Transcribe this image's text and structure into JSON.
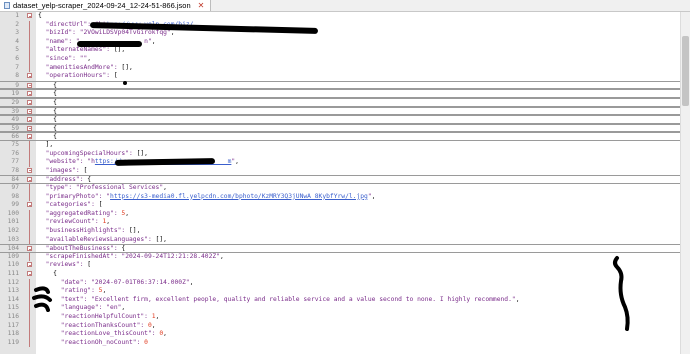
{
  "tab": {
    "title": "dataset_yelp-scraper_2024-09-24_12-24-51-866.json"
  },
  "lines": [
    {
      "n": "1",
      "fold": true,
      "parts": [
        [
          "p",
          "{"
        ]
      ]
    },
    {
      "n": "2",
      "parts": [
        [
          "k",
          "  \"directUrl\": "
        ],
        [
          "s",
          "\"ht"
        ],
        [
          "u",
          "tps://www.yelp.com/biz/"
        ],
        [
          "p",
          ""
        ]
      ]
    },
    {
      "n": "3",
      "parts": [
        [
          "k",
          "  \"bizId\": "
        ],
        [
          "s",
          "\"2VOwiLDSVp04TvGirokfqg\""
        ],
        [
          "p",
          ","
        ]
      ]
    },
    {
      "n": "4",
      "parts": [
        [
          "k",
          "  \"name\": "
        ],
        [
          "s",
          "\"                 n\""
        ],
        [
          "p",
          ","
        ]
      ]
    },
    {
      "n": "5",
      "parts": [
        [
          "k",
          "  \"alternateNames\": "
        ],
        [
          "p",
          "[],"
        ]
      ]
    },
    {
      "n": "6",
      "parts": [
        [
          "k",
          "  \"since\": "
        ],
        [
          "s",
          "\"\""
        ],
        [
          "p",
          ","
        ]
      ]
    },
    {
      "n": "7",
      "parts": [
        [
          "k",
          "  \"amenitiesAndMore\": "
        ],
        [
          "p",
          "[],"
        ]
      ]
    },
    {
      "n": "8",
      "fold": true,
      "parts": [
        [
          "k",
          "  \"operationHours\": "
        ],
        [
          "p",
          "["
        ]
      ]
    },
    {
      "n": "9",
      "fold": true,
      "box": true,
      "parts": [
        [
          "p",
          "    {"
        ]
      ]
    },
    {
      "n": "19",
      "fold": true,
      "box": true,
      "parts": [
        [
          "p",
          "    {"
        ]
      ]
    },
    {
      "n": "29",
      "fold": true,
      "box": true,
      "parts": [
        [
          "p",
          "    {"
        ]
      ]
    },
    {
      "n": "39",
      "fold": true,
      "box": true,
      "parts": [
        [
          "p",
          "    {"
        ]
      ]
    },
    {
      "n": "49",
      "fold": true,
      "box": true,
      "parts": [
        [
          "p",
          "    {"
        ]
      ]
    },
    {
      "n": "59",
      "fold": true,
      "box": true,
      "parts": [
        [
          "p",
          "    {"
        ]
      ]
    },
    {
      "n": "66",
      "fold": true,
      "box": true,
      "parts": [
        [
          "p",
          "    {"
        ]
      ]
    },
    {
      "n": "75",
      "parts": [
        [
          "p",
          "  ],"
        ]
      ]
    },
    {
      "n": "76",
      "parts": [
        [
          "k",
          "  \"upcomingSpecialHours\": "
        ],
        [
          "p",
          "[],"
        ]
      ]
    },
    {
      "n": "77",
      "parts": [
        [
          "k",
          "  \"website\": "
        ],
        [
          "s",
          "\"h"
        ],
        [
          "u",
          "ttps://www.                        m"
        ],
        [
          "s",
          "\""
        ],
        [
          "p",
          ","
        ]
      ]
    },
    {
      "n": "78",
      "fold": true,
      "parts": [
        [
          "k",
          "  \"images\": "
        ],
        [
          "p",
          "["
        ]
      ]
    },
    {
      "n": "84",
      "fold": true,
      "box": true,
      "parts": [
        [
          "k",
          "  \"address\": "
        ],
        [
          "p",
          "{"
        ]
      ]
    },
    {
      "n": "97",
      "parts": [
        [
          "k",
          "  \"type\": "
        ],
        [
          "s",
          "\"Professional Services\""
        ],
        [
          "p",
          ","
        ]
      ]
    },
    {
      "n": "98",
      "parts": [
        [
          "k",
          "  \"primaryPhoto\": "
        ],
        [
          "s",
          "\""
        ],
        [
          "u",
          "https://s3-media0.fl.yelpcdn.com/bphoto/KzMRY3Q3jUNwA_8KybfYrw/l.jpg"
        ],
        [
          "s",
          "\""
        ],
        [
          "p",
          ","
        ]
      ]
    },
    {
      "n": "99",
      "fold": true,
      "parts": [
        [
          "k",
          "  \"categories\": "
        ],
        [
          "p",
          "["
        ]
      ]
    },
    {
      "n": "100",
      "parts": [
        [
          "k",
          "  \"aggregatedRating\": "
        ],
        [
          "n",
          "5"
        ],
        [
          "p",
          ","
        ]
      ]
    },
    {
      "n": "101",
      "parts": [
        [
          "k",
          "  \"reviewCount\": "
        ],
        [
          "n",
          "1"
        ],
        [
          "p",
          ","
        ]
      ]
    },
    {
      "n": "102",
      "parts": [
        [
          "k",
          "  \"businessHighlights\": "
        ],
        [
          "p",
          "[],"
        ]
      ]
    },
    {
      "n": "103",
      "parts": [
        [
          "k",
          "  \"availableReviewsLanguages\": "
        ],
        [
          "p",
          "[],"
        ]
      ]
    },
    {
      "n": "104",
      "fold": true,
      "box": true,
      "parts": [
        [
          "k",
          "  \"aboutTheBusiness\": "
        ],
        [
          "p",
          "{"
        ]
      ]
    },
    {
      "n": "109",
      "parts": [
        [
          "k",
          "  \"scrapeFinishedAt\": "
        ],
        [
          "s",
          "\"2024-09-24T12:21:28.402Z\""
        ],
        [
          "p",
          ","
        ]
      ]
    },
    {
      "n": "110",
      "fold": true,
      "parts": [
        [
          "k",
          "  \"reviews\": "
        ],
        [
          "p",
          "["
        ]
      ]
    },
    {
      "n": "111",
      "fold": true,
      "parts": [
        [
          "p",
          "    {"
        ]
      ]
    },
    {
      "n": "112",
      "parts": [
        [
          "k",
          "      \"date\": "
        ],
        [
          "s",
          "\"2024-07-01T06:37:14.000Z\""
        ],
        [
          "p",
          ","
        ]
      ]
    },
    {
      "n": "113",
      "parts": [
        [
          "k",
          "      \"rating\": "
        ],
        [
          "n",
          "5"
        ],
        [
          "p",
          ","
        ]
      ]
    },
    {
      "n": "114",
      "parts": [
        [
          "k",
          "      \"text\": "
        ],
        [
          "s",
          "\"Excellent firm, excellent people, quality and reliable service and a value second to none. I highly recommend.\""
        ],
        [
          "p",
          ","
        ]
      ]
    },
    {
      "n": "115",
      "parts": [
        [
          "k",
          "      \"language\": "
        ],
        [
          "s",
          "\"en\""
        ],
        [
          "p",
          ","
        ]
      ]
    },
    {
      "n": "116",
      "parts": [
        [
          "k",
          "      \"reactionHelpfulCount\": "
        ],
        [
          "n",
          "1"
        ],
        [
          "p",
          ","
        ]
      ]
    },
    {
      "n": "117",
      "parts": [
        [
          "k",
          "      \"reactionThanksCount\": "
        ],
        [
          "n",
          "0"
        ],
        [
          "p",
          ","
        ]
      ]
    },
    {
      "n": "118",
      "parts": [
        [
          "k",
          "      \"reactionLove_thisCount\": "
        ],
        [
          "n",
          "0"
        ],
        [
          "p",
          ","
        ]
      ]
    },
    {
      "n": "119",
      "parts": [
        [
          "k",
          "      \"reactionOh_noCount\": "
        ],
        [
          "n",
          "0"
        ]
      ]
    }
  ]
}
